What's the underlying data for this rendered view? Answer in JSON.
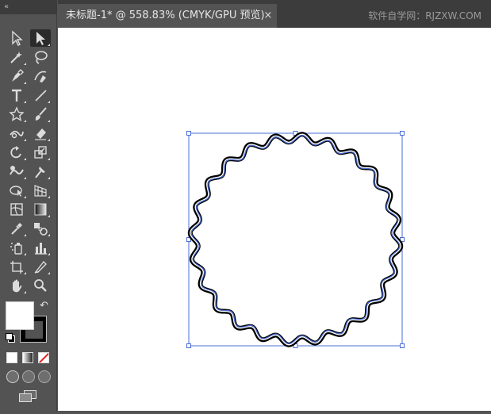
{
  "toolbar": {
    "collapse_label": "«",
    "tools": [
      {
        "name": "selection-tool-icon"
      },
      {
        "name": "direct-selection-tool-icon"
      },
      {
        "name": "magic-wand-tool-icon"
      },
      {
        "name": "lasso-tool-icon"
      },
      {
        "name": "pen-tool-icon"
      },
      {
        "name": "curvature-tool-icon"
      },
      {
        "name": "type-tool-icon"
      },
      {
        "name": "line-segment-tool-icon"
      },
      {
        "name": "star-tool-icon"
      },
      {
        "name": "paintbrush-tool-icon"
      },
      {
        "name": "shaper-tool-icon"
      },
      {
        "name": "eraser-tool-icon"
      },
      {
        "name": "rotate-tool-icon"
      },
      {
        "name": "scale-tool-icon"
      },
      {
        "name": "warp-tool-icon"
      },
      {
        "name": "puppet-warp-tool-icon"
      },
      {
        "name": "shape-builder-tool-icon"
      },
      {
        "name": "perspective-grid-tool-icon"
      },
      {
        "name": "mesh-tool-icon"
      },
      {
        "name": "gradient-tool-icon"
      },
      {
        "name": "eyedropper-tool-icon"
      },
      {
        "name": "blend-tool-icon"
      },
      {
        "name": "symbol-sprayer-tool-icon"
      },
      {
        "name": "column-graph-tool-icon"
      },
      {
        "name": "artboard-tool-icon"
      },
      {
        "name": "slice-tool-icon"
      },
      {
        "name": "hand-tool-icon"
      },
      {
        "name": "zoom-tool-icon"
      }
    ],
    "fill_color": "#ffffff",
    "stroke_color": "#000000"
  },
  "document_tab": {
    "title": "未标题-1* @ 558.83% (CMYK/GPU 预览)",
    "close_label": "×"
  },
  "watermark": "软件自学网：RJZXW.COM",
  "colors": {
    "selection": "#4a6cd4",
    "path_stroke": "#000000",
    "canvas": "#ffffff",
    "panel": "#535353"
  }
}
